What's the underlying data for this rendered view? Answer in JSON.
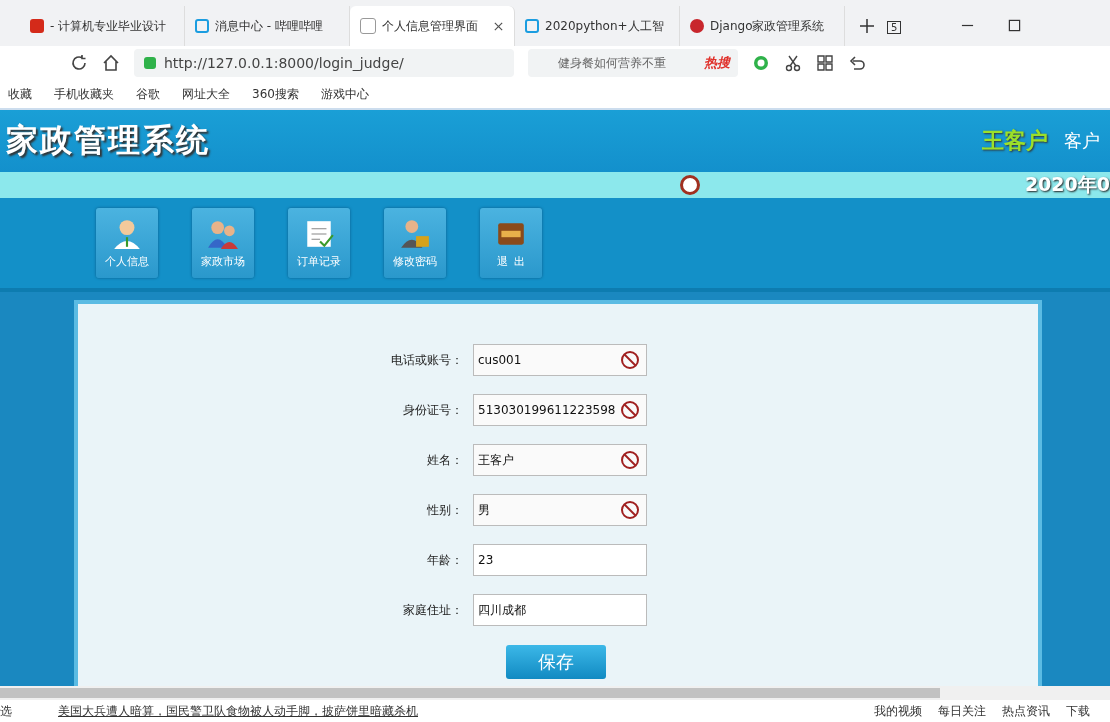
{
  "browser": {
    "tabs": [
      {
        "title": "- 计算机专业毕业设计",
        "selected": false
      },
      {
        "title": "消息中心 - 哔哩哔哩",
        "selected": false
      },
      {
        "title": "个人信息管理界面",
        "selected": true
      },
      {
        "title": "2020python+人工智",
        "selected": false
      },
      {
        "title": "Django家政管理系统",
        "selected": false
      }
    ],
    "tab_count": "5",
    "address": "http://127.0.0.1:8000/login_judge/",
    "search": {
      "value": "健身餐如何营养不重",
      "hot": "热搜"
    },
    "bookmarks": [
      "收藏",
      "手机收藏夹",
      "谷歌",
      "网址大全",
      "360搜索",
      "游戏中心"
    ]
  },
  "header": {
    "title": "家政管理系统",
    "user": "王客户",
    "role": "客户",
    "date": "2020年0"
  },
  "nav": [
    {
      "label": "个人信息"
    },
    {
      "label": "家政市场"
    },
    {
      "label": "订单记录"
    },
    {
      "label": "修改密码"
    },
    {
      "label": "退  出"
    }
  ],
  "form": {
    "fields": [
      {
        "label": "电话或账号：",
        "value": "cus001",
        "disabled": true
      },
      {
        "label": "身份证号：",
        "value": "513030199611223598",
        "disabled": true
      },
      {
        "label": "姓名：",
        "value": "王客户",
        "disabled": true
      },
      {
        "label": "性别：",
        "value": "男",
        "disabled": true
      },
      {
        "label": "年龄：",
        "value": "23",
        "disabled": false
      },
      {
        "label": "家庭住址：",
        "value": "四川成都",
        "disabled": false
      }
    ],
    "save": "保存"
  },
  "status_bar": {
    "left": "选",
    "news": "美国大兵遭人暗算，国民警卫队食物被人动手脚，披萨饼里暗藏杀机",
    "items": [
      "我的视频",
      "每日关注",
      "热点资讯",
      "下载"
    ]
  }
}
